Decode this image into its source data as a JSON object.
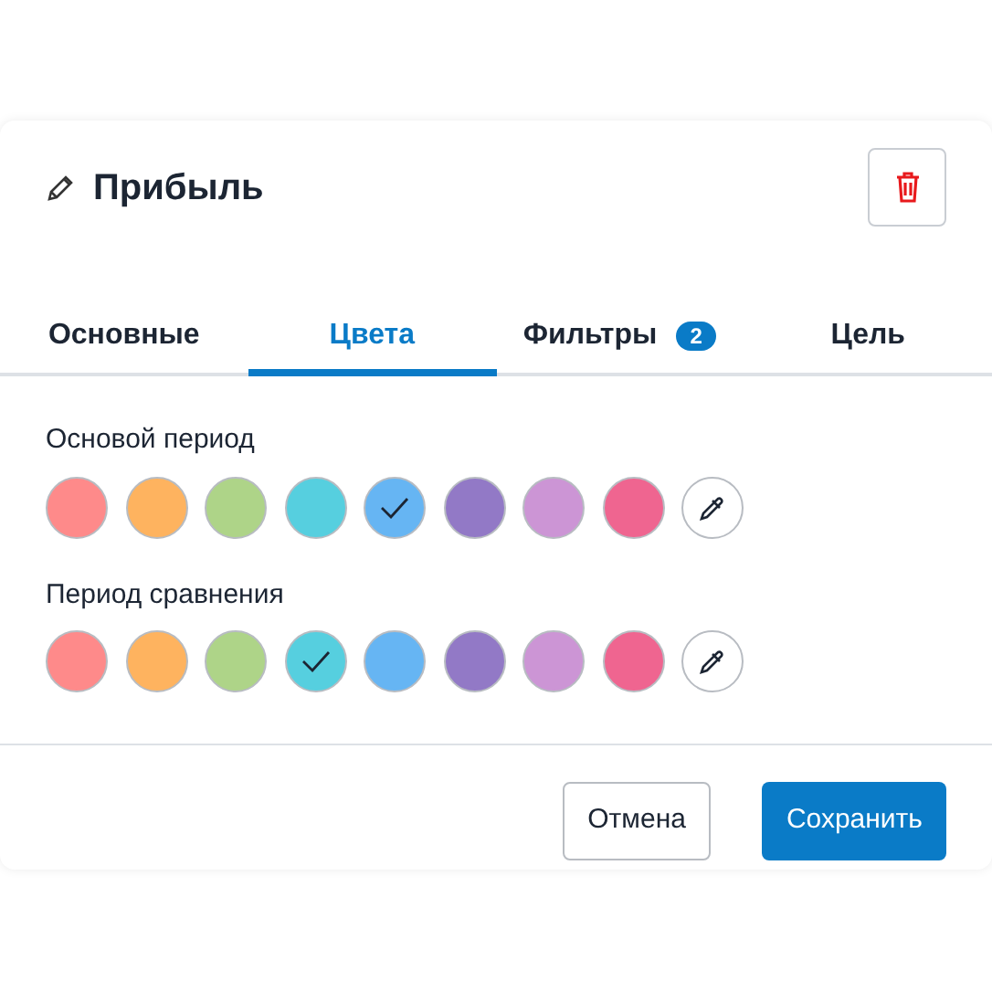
{
  "dialog": {
    "title": "Прибыль"
  },
  "tabs": [
    {
      "label": "Основные",
      "selected": false
    },
    {
      "label": "Цвета",
      "selected": true
    },
    {
      "label": "Фильтры",
      "badge": "2",
      "selected": false
    },
    {
      "label": "Цель",
      "selected": false
    }
  ],
  "palettes": [
    {
      "label": "Основой период",
      "swatches": [
        {
          "kind": "color",
          "color": "#fe8a8a",
          "selected": false
        },
        {
          "kind": "color",
          "color": "#feb35f",
          "selected": false
        },
        {
          "kind": "color",
          "color": "#aed488",
          "selected": false
        },
        {
          "kind": "color",
          "color": "#56cfdf",
          "selected": false
        },
        {
          "kind": "color",
          "color": "#66b5f3",
          "selected": true
        },
        {
          "kind": "color",
          "color": "#9279c6",
          "selected": false
        },
        {
          "kind": "color",
          "color": "#cc95d5",
          "selected": false
        },
        {
          "kind": "color",
          "color": "#ef6590",
          "selected": false
        },
        {
          "kind": "picker"
        }
      ]
    },
    {
      "label": "Период сравнения",
      "swatches": [
        {
          "kind": "color",
          "color": "#fe8a8a",
          "selected": false
        },
        {
          "kind": "color",
          "color": "#feb35f",
          "selected": false
        },
        {
          "kind": "color",
          "color": "#aed488",
          "selected": false
        },
        {
          "kind": "color",
          "color": "#56cfdf",
          "selected": true
        },
        {
          "kind": "color",
          "color": "#66b5f3",
          "selected": false
        },
        {
          "kind": "color",
          "color": "#9279c6",
          "selected": false
        },
        {
          "kind": "color",
          "color": "#cc95d5",
          "selected": false
        },
        {
          "kind": "color",
          "color": "#ef6590",
          "selected": false
        },
        {
          "kind": "picker"
        }
      ]
    }
  ],
  "buttons": [
    {
      "kind": "secondary",
      "label": "Отмена"
    },
    {
      "kind": "primary",
      "label": "Сохранить"
    }
  ]
}
